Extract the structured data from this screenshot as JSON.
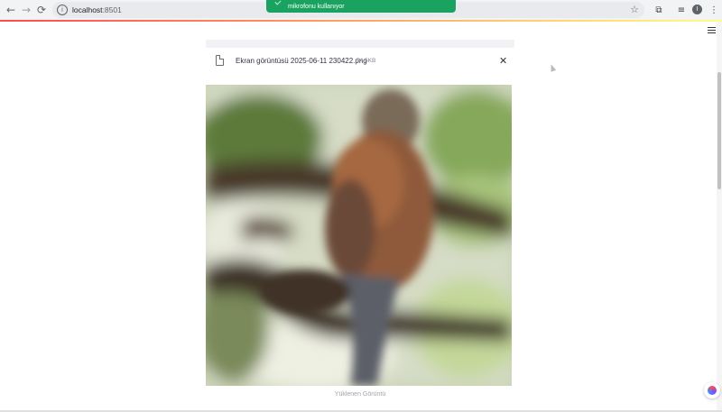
{
  "browser": {
    "back_icon": "←",
    "forward_icon": "→",
    "reload_icon": "⟳",
    "url_host": "localhost",
    "url_port": ":8501",
    "star_icon": "☆",
    "profile_initial": "I"
  },
  "toast": {
    "text": "mikrofonu kullanıyor"
  },
  "uploader": {
    "file_name": "Ekran görüntüsü 2025-06-11 230422.png",
    "file_size": "74.5KB",
    "remove_icon": "✕"
  },
  "image": {
    "caption": "Yüklenen Görüntü"
  },
  "colors": {
    "accent_red": "#ff4b4b",
    "toast_green": "#1aa260"
  }
}
